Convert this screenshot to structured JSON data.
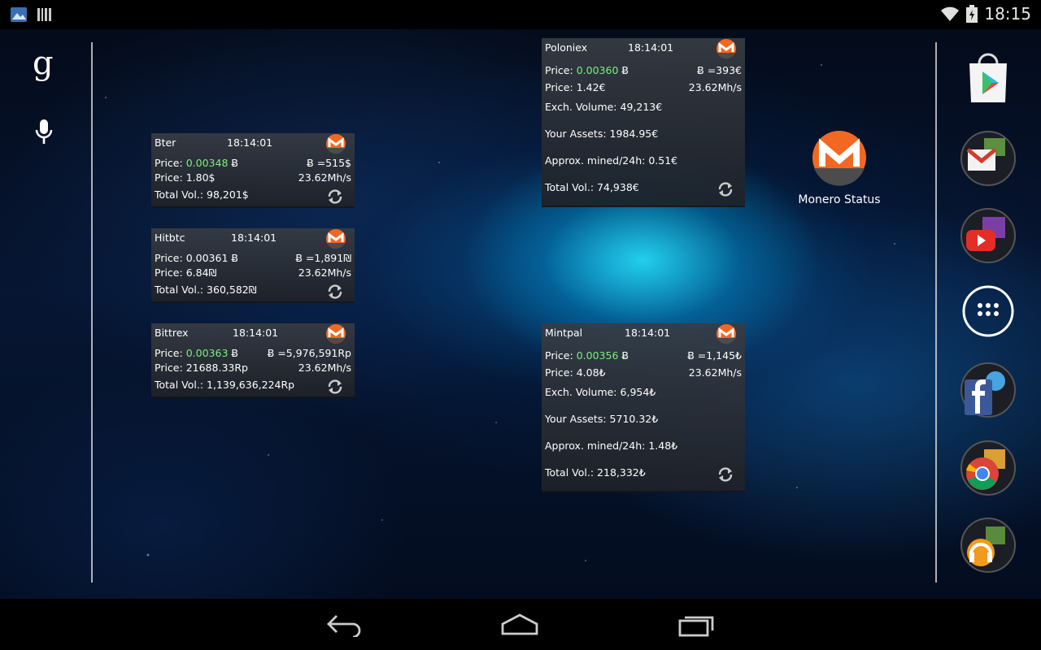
{
  "status_bar": {
    "time": "18:15"
  },
  "search": {
    "google_glyph": "g"
  },
  "widgets": {
    "bter": {
      "exchange": "Bter",
      "time": "18:14:01",
      "price_btc": "0.00348",
      "btc_symbol": "Ƀ",
      "btc_symbol2": "Ƀ",
      "fiat_value": "=515$",
      "price_fiat": "1.80$",
      "hashrate": "23.62Mh/s",
      "total_vol": "98,201$",
      "labels": {
        "price": "Price:",
        "total": "Total Vol.:"
      }
    },
    "hitbtc": {
      "exchange": "Hitbtc",
      "time": "18:14:01",
      "price_btc": "0.00361",
      "btc_symbol": "Ƀ",
      "btc_symbol2": "Ƀ",
      "fiat_value": "=1,891₪",
      "price_fiat": "6.84₪",
      "hashrate": "23.62Mh/s",
      "total_vol": "360,582₪",
      "labels": {
        "price": "Price:",
        "total": "Total Vol.:"
      }
    },
    "bittrex": {
      "exchange": "Bittrex",
      "time": "18:14:01",
      "price_btc": "0.00363",
      "btc_symbol": "Ƀ",
      "btc_symbol2": "Ƀ",
      "fiat_value": "=5,976,591Rp",
      "price_fiat": "21688.33Rp",
      "hashrate": "23.62Mh/s",
      "total_vol": "1,139,636,224Rp",
      "labels": {
        "price": "Price:",
        "total": "Total Vol.:"
      }
    },
    "poloniex": {
      "exchange": "Poloniex",
      "time": "18:14:01",
      "price_btc": "0.00360",
      "btc_symbol": "Ƀ",
      "btc_symbol2": "Ƀ",
      "fiat_value": "=393€",
      "price_fiat": "1.42€",
      "hashrate": "23.62Mh/s",
      "exch_volume": "49,213€",
      "assets": "1984.95€",
      "mined": "0.51€",
      "total_vol": "74,938€",
      "labels": {
        "price": "Price:",
        "exch": "Exch. Volume:",
        "assets": "Your Assets:",
        "mined": "Approx. mined/24h:",
        "total": "Total Vol.:"
      }
    },
    "mintpal": {
      "exchange": "Mintpal",
      "time": "18:14:01",
      "price_btc": "0.00356",
      "btc_symbol": "Ƀ",
      "btc_symbol2": "Ƀ",
      "fiat_value": "=1,145₺",
      "price_fiat": "4.08₺",
      "hashrate": "23.62Mh/s",
      "exch_volume": "6,954₺",
      "assets": "5710.32₺",
      "mined": "1.48₺",
      "total_vol": "218,332₺",
      "labels": {
        "price": "Price:",
        "exch": "Exch. Volume:",
        "assets": "Your Assets:",
        "mined": "Approx. mined/24h:",
        "total": "Total Vol.:"
      }
    }
  },
  "app_shortcut": {
    "label": "Monero Status",
    "icon": "monero-icon"
  },
  "dock": [
    "play-store-icon",
    "gmail-icon",
    "youtube-icon",
    "all-apps-icon",
    "facebook-icon",
    "chrome-icon",
    "play-music-icon"
  ],
  "nav": [
    "back-icon",
    "home-icon",
    "recents-icon"
  ],
  "colors": {
    "price_green": "#7cf07c",
    "monero_orange": "#f26822",
    "widget_bg": "#30343c"
  }
}
